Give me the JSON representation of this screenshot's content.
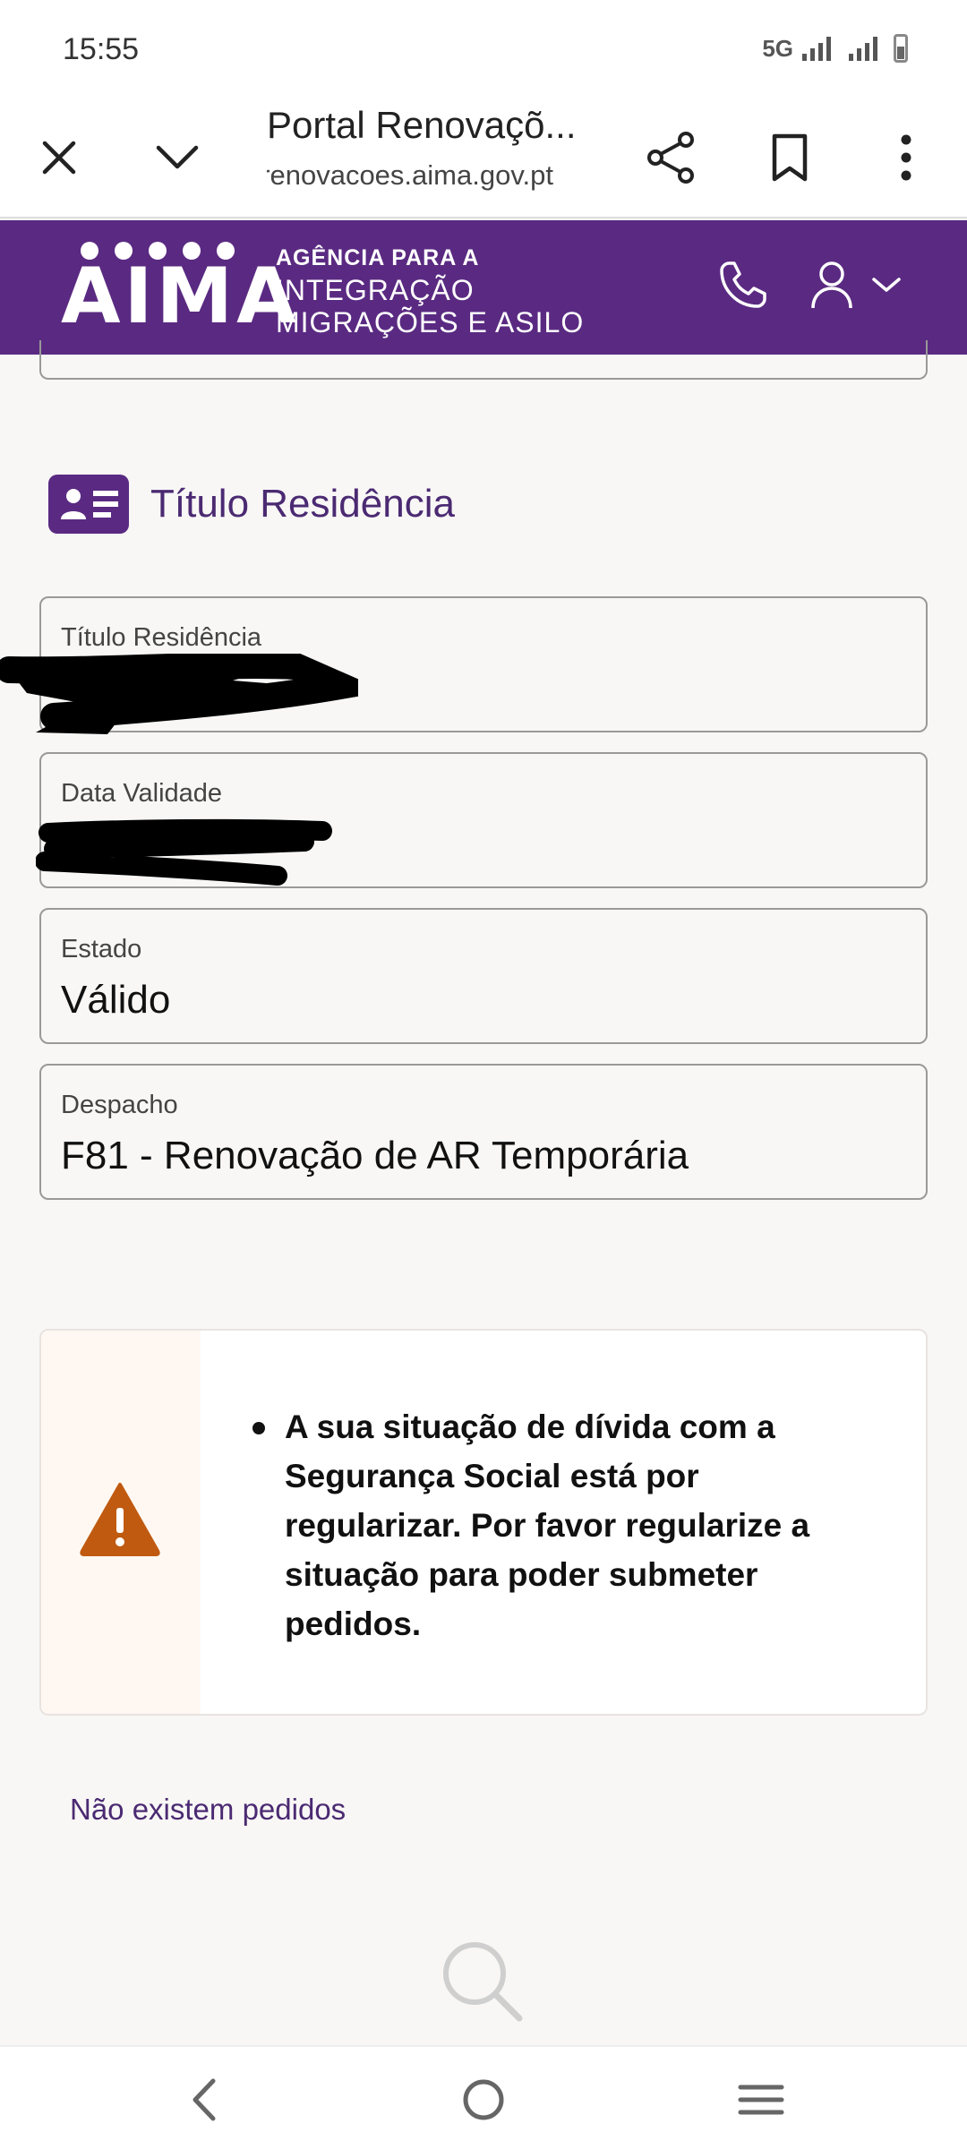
{
  "status_bar": {
    "time": "15:55",
    "network": "5G"
  },
  "browser": {
    "page_title": "Portal Renovaçõ...",
    "url": "renovacoes.aima.gov.pt"
  },
  "site_header": {
    "logo_text": "AIMA",
    "agency_line1": "AGÊNCIA PARA A",
    "agency_line2": "INTEGRAÇÃO",
    "agency_line3": "MIGRAÇÕES E ASILO",
    "brand_color": "#5a2a82"
  },
  "section": {
    "title": "Título Residência"
  },
  "fields": [
    {
      "label": "Título Residência",
      "value": ""
    },
    {
      "label": "Data Validade",
      "value": ""
    },
    {
      "label": "Estado",
      "value": "Válido"
    },
    {
      "label": "Despacho",
      "value": "F81 - Renovação de AR Temporária"
    }
  ],
  "alert": {
    "icon": "warning-icon",
    "message": "A sua situação de dívida com a Segurança Social está por regularizar. Por favor regularize a situação para poder submeter pedidos.",
    "accent_color": "#c05a10"
  },
  "no_requests_text": "Não existem pedidos"
}
